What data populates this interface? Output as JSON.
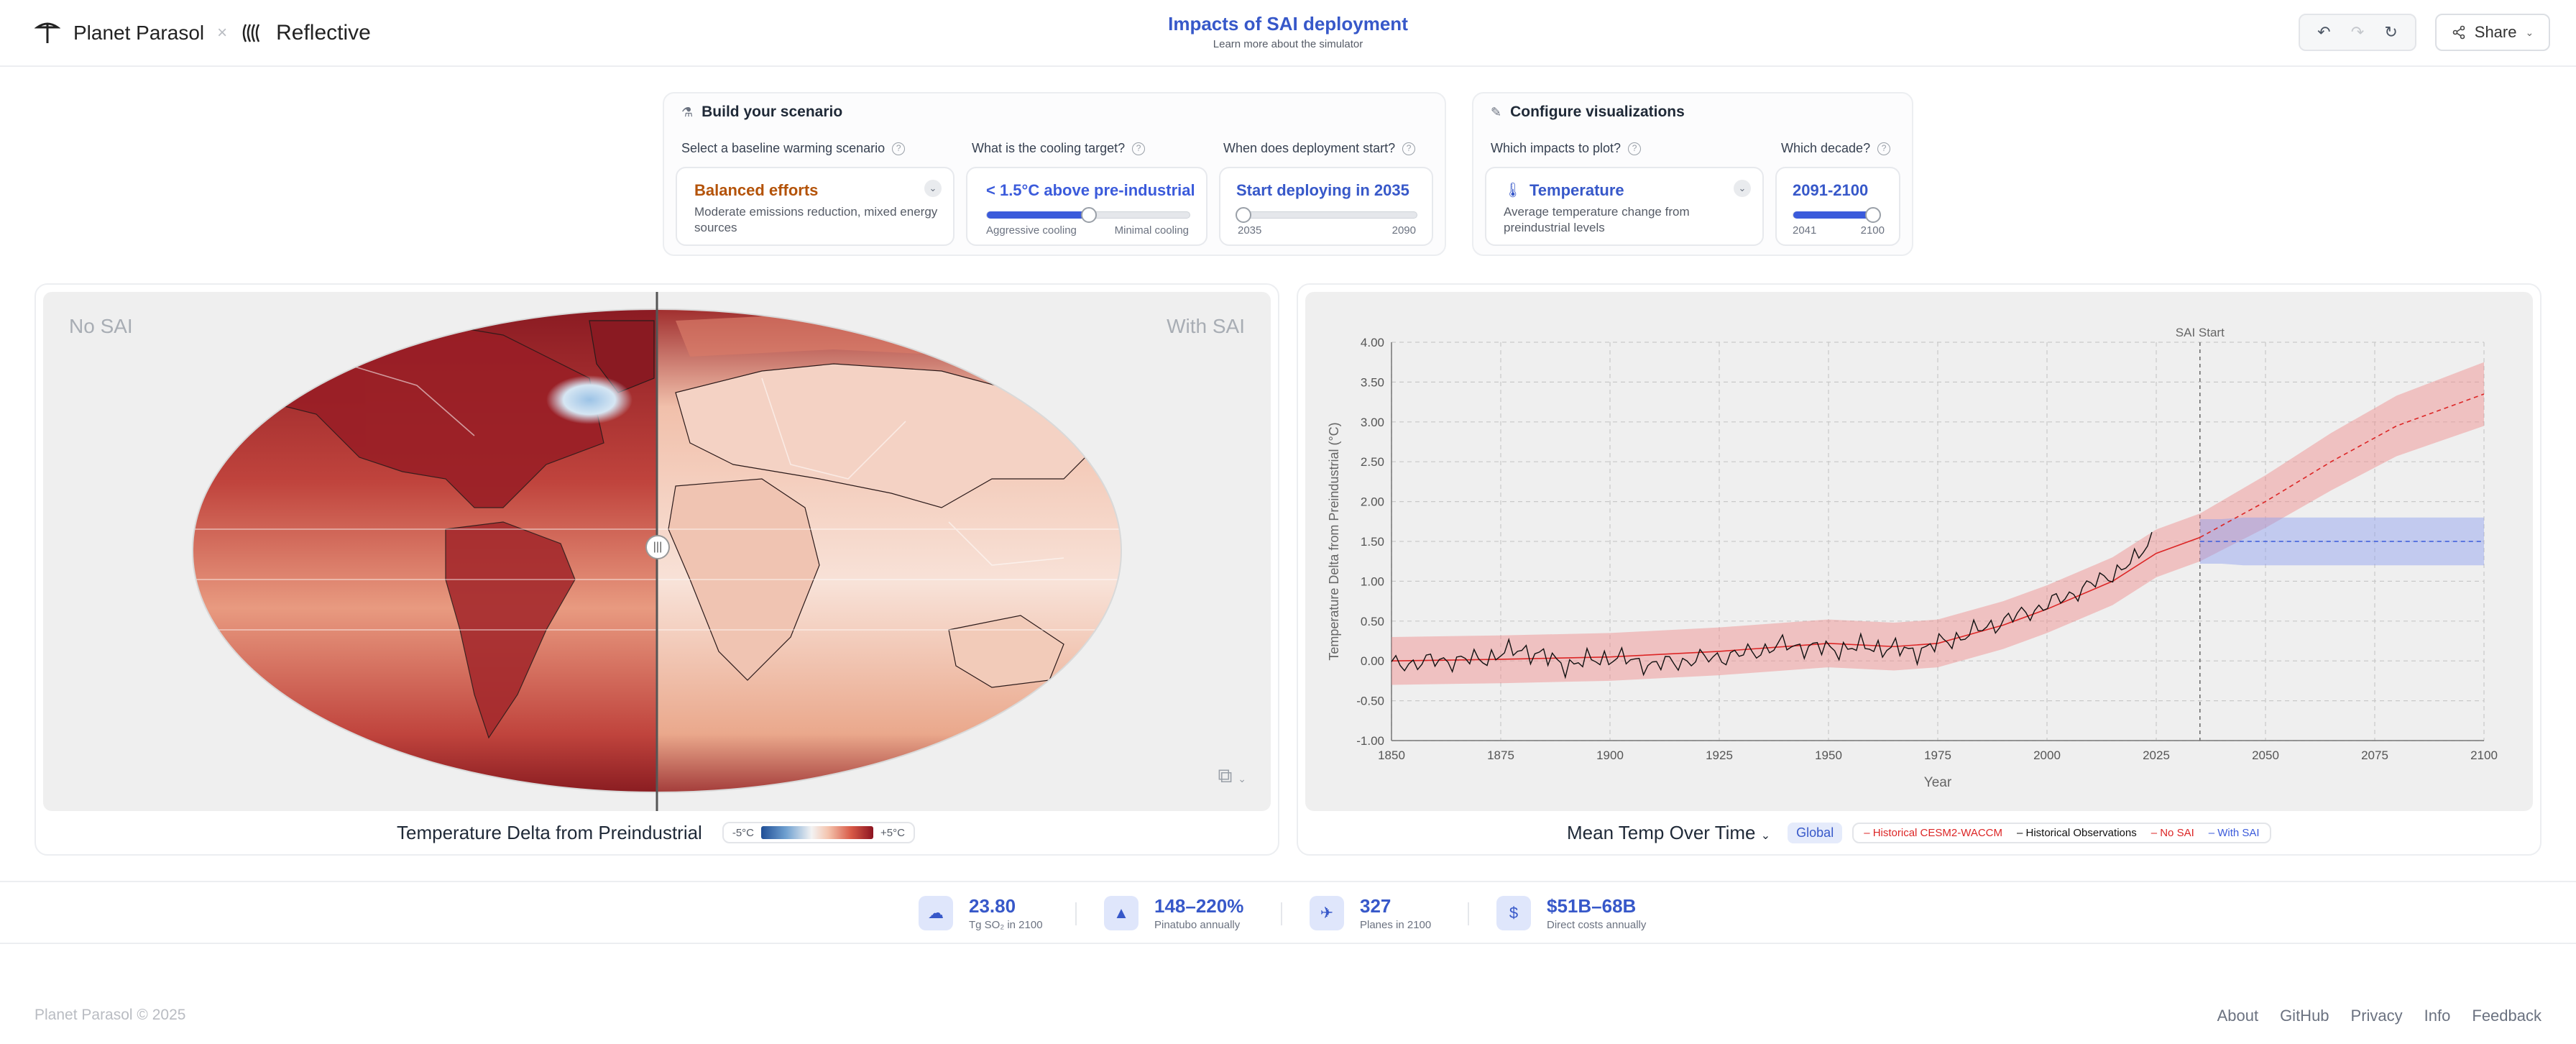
{
  "header": {
    "brand_left": "Planet Parasol",
    "brand_sep": "×",
    "brand_right": "Reflective",
    "title": "Impacts of SAI deployment",
    "subtitle": "Learn more about the simulator",
    "share_label": "Share"
  },
  "scenario": {
    "title": "Build your scenario",
    "q_baseline": "Select a baseline warming scenario",
    "baseline_value": "Balanced efforts",
    "baseline_desc": "Moderate emissions reduction, mixed energy sources",
    "q_cooling": "What is the cooling target?",
    "cooling_value": "< 1.5°C above pre-industrial",
    "cooling_left": "Aggressive cooling",
    "cooling_right": "Minimal cooling",
    "cooling_level": 0.5,
    "q_start": "When does deployment start?",
    "start_value": "Start deploying in 2035",
    "start_min": "2035",
    "start_max": "2090",
    "start_level": 0.0
  },
  "visualizations": {
    "title": "Configure visualizations",
    "q_impacts": "Which impacts to plot?",
    "impact_value": "Temperature",
    "impact_desc": "Average temperature change from preindustrial levels",
    "q_decade": "Which decade?",
    "decade_value": "2091-2100",
    "decade_min": "2041",
    "decade_max": "2100",
    "decade_level": 0.82
  },
  "map": {
    "label_left": "No SAI",
    "label_right": "With SAI",
    "title": "Temperature Delta from Preindustrial",
    "cb_min": "-5°C",
    "cb_max": "+5°C"
  },
  "chart_footer": {
    "title": "Mean Temp Over Time",
    "region": "Global",
    "legend": [
      {
        "label": "Historical CESM2-WACCM",
        "color": "#dc2626"
      },
      {
        "label": "Historical Observations",
        "color": "#111111"
      },
      {
        "label": "No SAI",
        "color": "#dc2626"
      },
      {
        "label": "With SAI",
        "color": "#3b5bdb"
      }
    ]
  },
  "chart_data": {
    "type": "line",
    "xlabel": "Year",
    "ylabel": "Temperature Delta from Preindustrial (°C)",
    "xlim": [
      1850,
      2100
    ],
    "ylim": [
      -1.0,
      4.0
    ],
    "xticks": [
      1850,
      1875,
      1900,
      1925,
      1950,
      1975,
      2000,
      2025,
      2050,
      2075,
      2100
    ],
    "yticks": [
      "-1.00",
      "-0.50",
      "0.00",
      "0.50",
      "1.00",
      "1.50",
      "2.00",
      "2.50",
      "3.00",
      "3.50",
      "4.00"
    ],
    "grid": true,
    "annotation": {
      "x": 2035,
      "label": "SAI Start"
    },
    "series": [
      {
        "name": "Historical CESM2-WACCM",
        "color": "#dc2626",
        "x": [
          1850,
          1875,
          1900,
          1925,
          1950,
          1965,
          1975,
          1990,
          2000,
          2015,
          2025,
          2035
        ],
        "y": [
          0.0,
          0.02,
          0.05,
          0.12,
          0.22,
          0.18,
          0.22,
          0.45,
          0.65,
          1.0,
          1.35,
          1.55
        ],
        "band": [
          0.3,
          0.3,
          0.3,
          0.3,
          0.3,
          0.3,
          0.3,
          0.3,
          0.3,
          0.3,
          0.3,
          0.3
        ]
      },
      {
        "name": "Historical Observations",
        "color": "#111111",
        "x": [
          1850,
          1860,
          1870,
          1880,
          1890,
          1900,
          1910,
          1920,
          1930,
          1940,
          1950,
          1960,
          1970,
          1980,
          1990,
          2000,
          2010,
          2020,
          2024
        ],
        "y": [
          -0.05,
          0.0,
          0.02,
          0.15,
          -0.05,
          0.05,
          -0.05,
          0.02,
          0.08,
          0.2,
          0.15,
          0.18,
          0.12,
          0.3,
          0.5,
          0.7,
          0.95,
          1.25,
          1.55
        ]
      },
      {
        "name": "No SAI",
        "color": "#dc2626",
        "x": [
          2035,
          2050,
          2065,
          2080,
          2090,
          2100
        ],
        "y": [
          1.55,
          2.0,
          2.5,
          2.95,
          3.15,
          3.35
        ],
        "band": [
          0.3,
          0.33,
          0.36,
          0.38,
          0.39,
          0.4
        ]
      },
      {
        "name": "With SAI",
        "color": "#3b5bdb",
        "x": [
          2035,
          2040,
          2045,
          2060,
          2080,
          2100
        ],
        "y": [
          1.5,
          1.5,
          1.5,
          1.5,
          1.5,
          1.5
        ],
        "band": [
          0.28,
          0.28,
          0.3,
          0.3,
          0.3,
          0.3
        ]
      }
    ]
  },
  "stats": [
    {
      "value": "23.80",
      "label": "Tg SO₂ in 2100",
      "icon": "cloud-icon"
    },
    {
      "value": "148–220%",
      "label": "Pinatubo annually",
      "icon": "volcano-icon"
    },
    {
      "value": "327",
      "label": "Planes in 2100",
      "icon": "plane-icon"
    },
    {
      "value": "$51B–68B",
      "label": "Direct costs annually",
      "icon": "money-icon"
    }
  ],
  "footer": {
    "copyright": "Planet Parasol © 2025",
    "links": [
      "About",
      "GitHub",
      "Privacy",
      "Info",
      "Feedback"
    ]
  }
}
